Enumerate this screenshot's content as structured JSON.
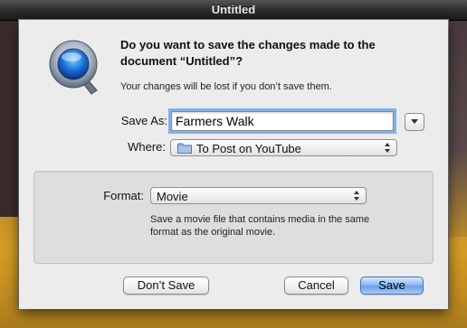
{
  "window": {
    "title": "Untitled"
  },
  "dialog": {
    "app_icon": "quicktime-icon",
    "heading": "Do you want to save the changes made to the document “Untitled”?",
    "subtext": "Your changes will be lost if you don’t save them.",
    "save_as": {
      "label": "Save As:",
      "value": "Farmers Walk"
    },
    "disclosure_icon": "disclosure-triangle-icon",
    "where": {
      "label": "Where:",
      "value": "To Post on YouTube",
      "icon": "folder-icon"
    },
    "format": {
      "label": "Format:",
      "value": "Movie",
      "description": "Save a movie file that contains media in the same format as the original movie."
    },
    "buttons": {
      "dont_save": "Don’t Save",
      "cancel": "Cancel",
      "save": "Save"
    }
  },
  "colors": {
    "accent": "#6aa0e8",
    "focus_ring": "#7fb1ea",
    "sheet": "#ececec"
  }
}
